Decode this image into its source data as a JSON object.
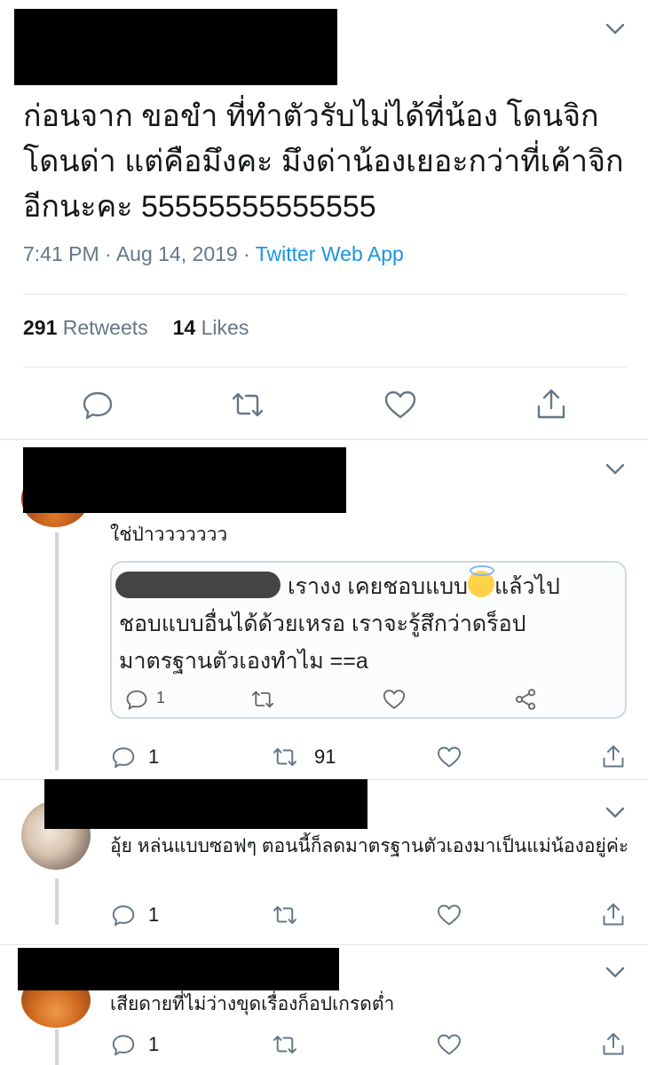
{
  "main_tweet": {
    "text": "ก่อนจาก ขอขำ ที่ทำตัวรับไม่ได้ที่น้อง โดนจิก โดนด่า แต่คือมึงคะ มึงด่าน้องเยอะกว่าที่เค้าจิกอีกนะคะ 55555555555555",
    "time": "7:41 PM",
    "date": "Aug 14, 2019",
    "dot": "·",
    "source": "Twitter Web App",
    "retweets_count": "291",
    "retweets_label": "Retweets",
    "likes_count": "14",
    "likes_label": "Likes"
  },
  "replies": [
    {
      "text": "ใช่ป่าววววววว",
      "quoted": {
        "line1": "เรางง เคยชอบแบบ",
        "line1b": "แล้วไป",
        "line2": "ชอบแบบอื่นได้ด้วยเหรอ เราจะรู้สึกว่าดร็อป",
        "line3": "มาตรฐานตัวเองทำไม ==a",
        "reply_count": "1"
      },
      "reply_count": "1",
      "retweet_count": "91",
      "like_count": ""
    },
    {
      "text": "อุ้ย หล่นแบบซอฟๆ ตอนนี้ก็ลดมาตรฐานตัวเองมาเป็นแม่น้องอยู่ค่ะ",
      "reply_count": "1",
      "retweet_count": "",
      "like_count": ""
    },
    {
      "text": "เสียดายที่ไม่ว่างขุดเรื่องก็อปเกรดต่ำ",
      "reply_count": "1",
      "retweet_count": "",
      "like_count": ""
    }
  ],
  "colors": {
    "link": "#1b95e0",
    "muted": "#657786",
    "icon": "#657786",
    "divider": "#e1e8ed",
    "redaction": "#000000"
  },
  "icons": [
    "chevron-down-icon",
    "reply-icon",
    "retweet-icon",
    "like-icon",
    "share-icon"
  ]
}
